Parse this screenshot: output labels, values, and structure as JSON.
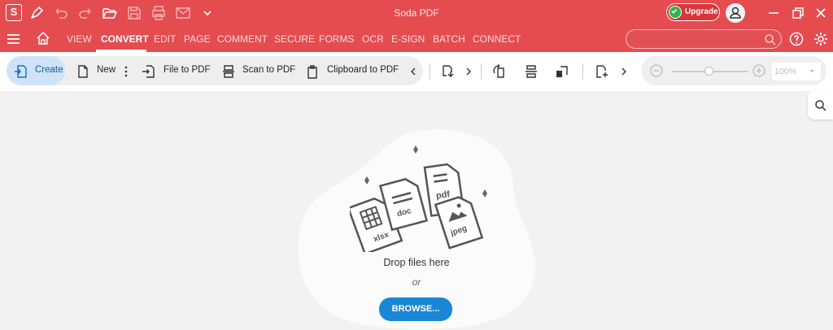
{
  "app": {
    "title": "Soda PDF",
    "logo_letter": "S"
  },
  "header": {
    "upgrade_label": "Upgrade"
  },
  "menu": {
    "items": [
      "VIEW",
      "CONVERT",
      "EDIT",
      "PAGE",
      "COMMENT",
      "SECURE",
      "FORMS",
      "OCR",
      "E-SIGN",
      "BATCH",
      "CONNECT"
    ],
    "active": "CONVERT",
    "search_placeholder": ""
  },
  "toolbar": {
    "create_label": "Create",
    "new_label": "New",
    "file_to_pdf_label": "File to PDF",
    "scan_to_pdf_label": "Scan to PDF",
    "clipboard_to_pdf_label": "Clipboard to PDF",
    "zoom_value": "100%"
  },
  "dropzone": {
    "drop_text": "Drop files here",
    "or_text": "or",
    "browse_label": "BROWSE...",
    "file_labels": [
      "xlsx",
      "doc",
      "pdf",
      "jpeg"
    ]
  },
  "colors": {
    "brand": "#e44c50",
    "accent": "#1a86d6",
    "upgrade_check": "#32b44b"
  }
}
